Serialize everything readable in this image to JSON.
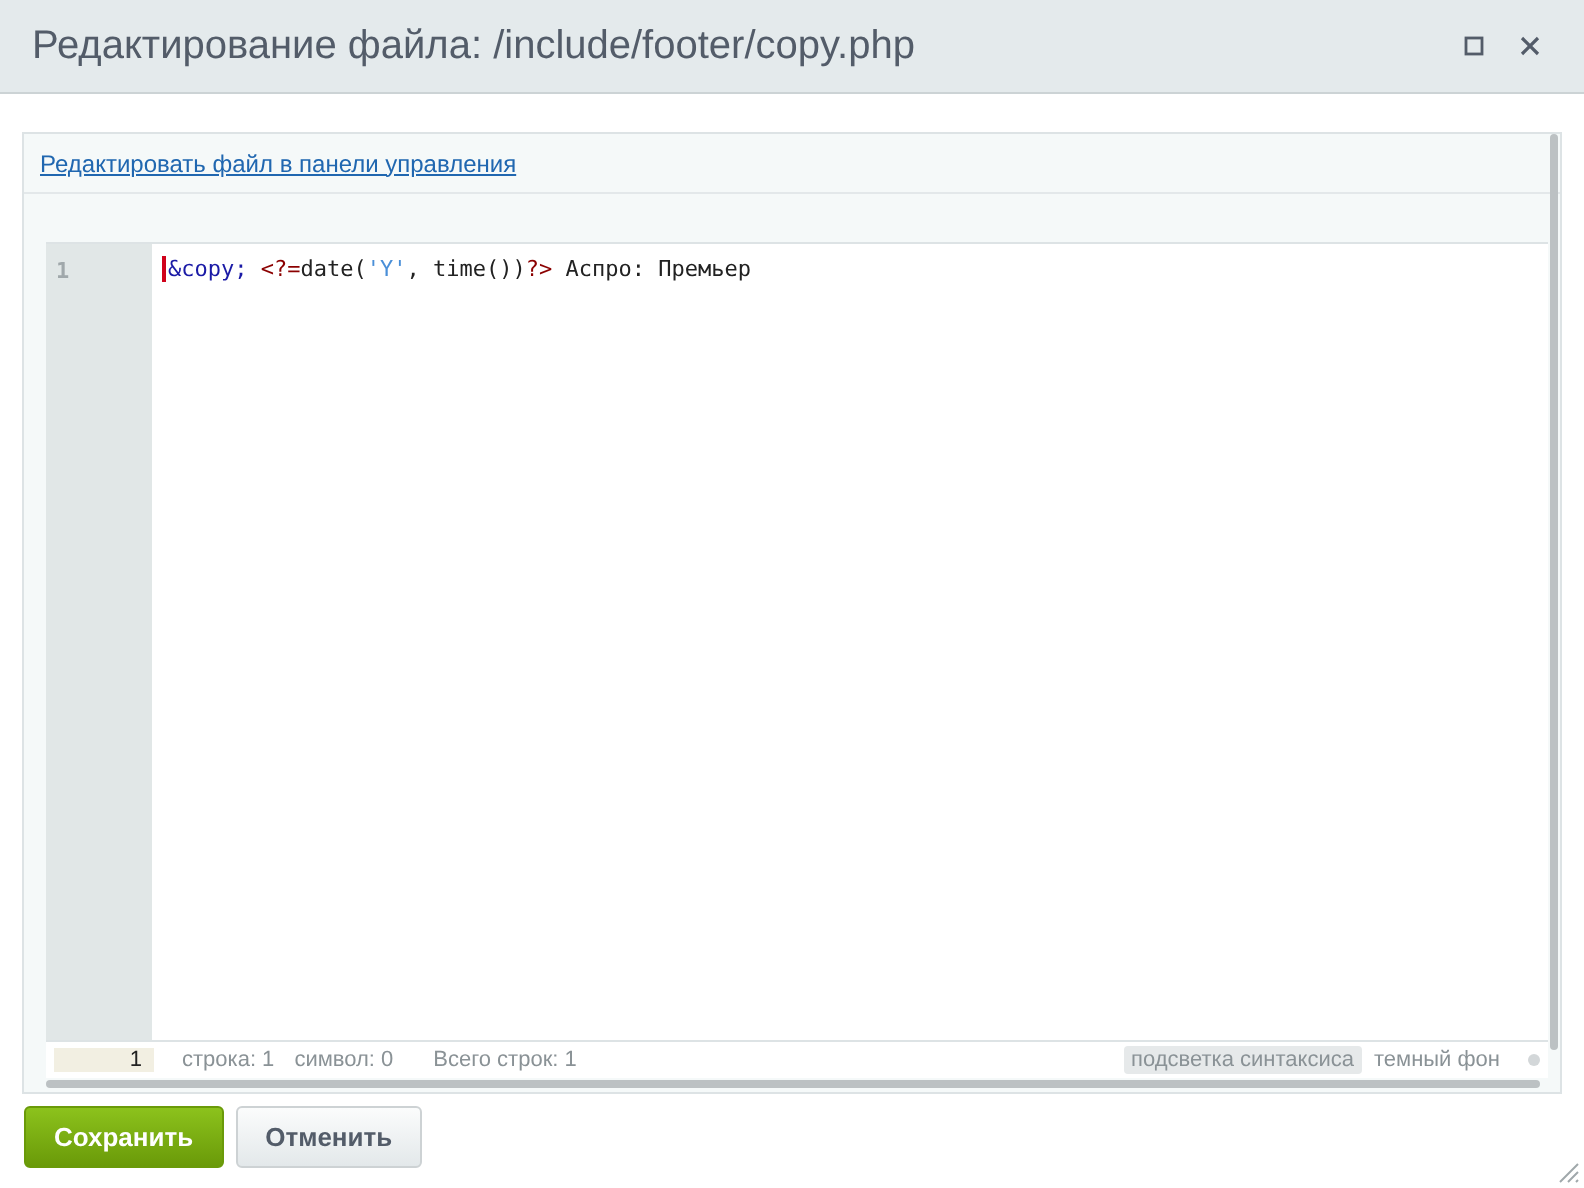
{
  "window": {
    "title": "Редактирование файла: /include/footer/copy.php"
  },
  "link": "Редактировать файл в панели управления",
  "editor": {
    "line_numbers": [
      "1"
    ],
    "lines": [
      [
        {
          "kind": "entity",
          "text": "&copy;"
        },
        {
          "kind": "tag",
          "text": " <?="
        },
        {
          "kind": "plain",
          "text": "date("
        },
        {
          "kind": "string",
          "text": "'Y'"
        },
        {
          "kind": "plain",
          "text": ", time())"
        },
        {
          "kind": "tag",
          "text": "?>"
        },
        {
          "kind": "plain",
          "text": " Аспро: Премьер"
        }
      ]
    ]
  },
  "status_bar": {
    "goto_line": "1",
    "line": "строка: 1",
    "symbol": "символ: 0",
    "total": "Всего строк: 1",
    "toggles": [
      {
        "label": "подсветка синтаксиса",
        "selected": true
      },
      {
        "label": "темный фон",
        "selected": false
      }
    ]
  },
  "buttons": [
    {
      "kind": "primary",
      "label": "Сохранить"
    },
    {
      "kind": "secondary",
      "label": "Отменить"
    }
  ]
}
